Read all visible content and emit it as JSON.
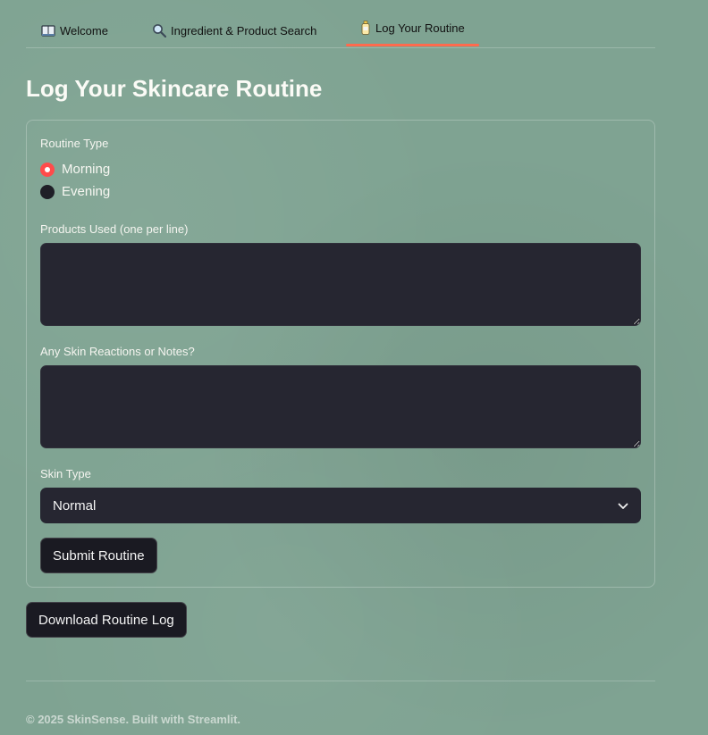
{
  "tabs": [
    {
      "label": "Welcome",
      "icon": "book-icon"
    },
    {
      "label": "Ingredient & Product Search",
      "icon": "magnifier-icon"
    },
    {
      "label": "Log Your Routine",
      "icon": "lotion-bottle-icon",
      "active": true
    }
  ],
  "page": {
    "title": "Log Your Skincare Routine"
  },
  "form": {
    "routine_type_label": "Routine Type",
    "routine_options": [
      "Morning",
      "Evening"
    ],
    "routine_selected": "Morning",
    "products_label": "Products Used (one per line)",
    "products_value": "",
    "notes_label": "Any Skin Reactions or Notes?",
    "notes_value": "",
    "skin_type_label": "Skin Type",
    "skin_type_value": "Normal",
    "submit_label": "Submit Routine"
  },
  "download_label": "Download Routine Log",
  "footer": {
    "text": "© 2025 SkinSense. Built with Streamlit."
  },
  "colors": {
    "background": "#7fa392",
    "accent": "#ff4b4b",
    "tab_underline": "#ff6a4d",
    "input_bg": "#262631",
    "button_bg": "#1a1a22"
  }
}
